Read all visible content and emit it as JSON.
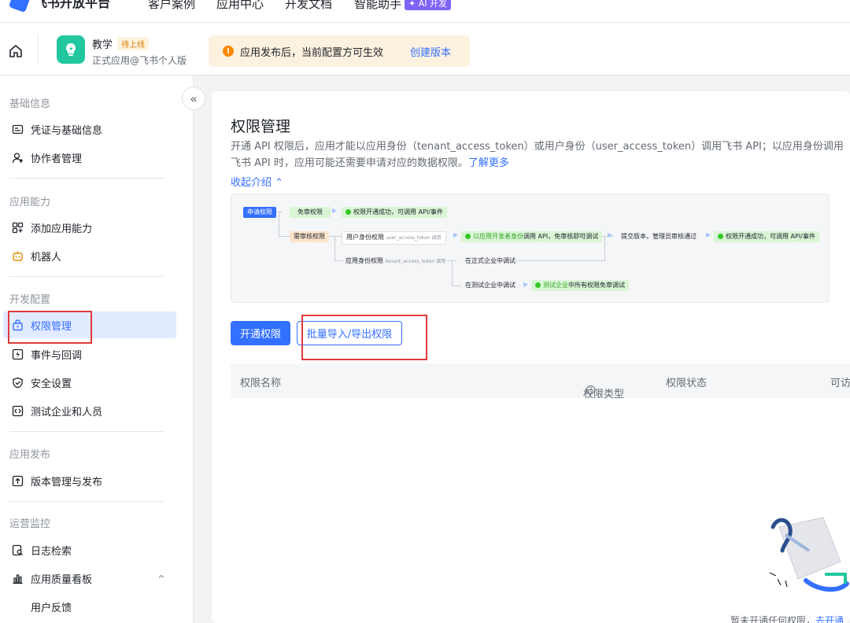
{
  "topnav": {
    "brand": "飞书开放平台",
    "items": [
      "客户案例",
      "应用中心",
      "开发文档",
      "智能助手"
    ],
    "ai_badge": "AI 开发"
  },
  "app": {
    "name": "教学",
    "status_badge": "待上线",
    "subtitle": "正式应用@飞书个人版"
  },
  "notice": {
    "text": "应用发布后，当前配置方可生效",
    "link": "创建版本"
  },
  "sidebar": {
    "sections": [
      {
        "title": "基础信息",
        "items": [
          "凭证与基础信息",
          "协作者管理"
        ]
      },
      {
        "title": "应用能力",
        "items": [
          "添加应用能力",
          "机器人"
        ]
      },
      {
        "title": "开发配置",
        "items": [
          "权限管理",
          "事件与回调",
          "安全设置",
          "测试企业和人员"
        ]
      },
      {
        "title": "应用发布",
        "items": [
          "版本管理与发布"
        ]
      },
      {
        "title": "运营监控",
        "items": [
          "日志检索",
          "应用质量看板",
          "用户反馈"
        ]
      }
    ],
    "active_item": "权限管理"
  },
  "main": {
    "title": "权限管理",
    "description": "开通 API 权限后，应用才能以应用身份（tenant_access_token）或用户身份（user_access_token）调用飞书 API；以应用身份调用飞书 API 时，应用可能还需要申请对应的数据权限。",
    "learn_more": "了解更多",
    "collapse_link": "收起介绍",
    "flow": {
      "apply": "申请权限",
      "free_review": "免审权限",
      "free_result": "权限开通成功，可调用 API/事件",
      "need_review": "需审核权限",
      "user_perm": "用户身份权限",
      "user_perm_note": "user_access_token 调用",
      "dev_debug_pre": "以应用开发者身份",
      "dev_debug_post": "调用 API，免审核即可调试",
      "submit": "提交版本，管理员审核通过",
      "final_result": "权限开通成功，可调用 API/事件",
      "app_perm": "应用身份权限",
      "app_perm_note": "tenant_access_token 调用",
      "formal_debug": "在正式企业中调试",
      "test_debug": "在测试企业中调试",
      "test_free_pre": "测试企业",
      "test_free_post": "中所有权限免审调试"
    },
    "btn_enable": "开通权限",
    "btn_batch": "批量导入/导出权限",
    "table_headers": [
      "权限名称",
      "权限类型",
      "权限状态",
      "可访"
    ],
    "empty_text": "暂未开通任何权限，",
    "empty_link": "去开通"
  }
}
